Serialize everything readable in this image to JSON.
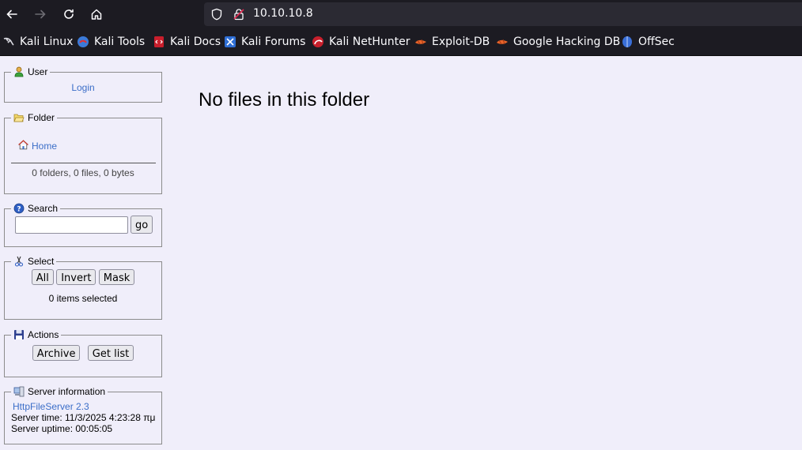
{
  "browser": {
    "url": "10.10.10.8",
    "bookmarks": [
      {
        "label": "Kali Linux",
        "icon": "kali-dragon-icon"
      },
      {
        "label": "Kali Tools",
        "icon": "kali-tools-icon"
      },
      {
        "label": "Kali Docs",
        "icon": "kali-docs-icon"
      },
      {
        "label": "Kali Forums",
        "icon": "kali-forums-icon"
      },
      {
        "label": "Kali NetHunter",
        "icon": "nethunter-icon"
      },
      {
        "label": "Exploit-DB",
        "icon": "exploit-db-icon"
      },
      {
        "label": "Google Hacking DB",
        "icon": "ghdb-icon"
      },
      {
        "label": "OffSec",
        "icon": "offsec-icon"
      }
    ]
  },
  "panels": {
    "user": {
      "title": "User",
      "login": "Login"
    },
    "folder": {
      "title": "Folder",
      "home": "Home",
      "stats": "0 folders, 0 files, 0 bytes"
    },
    "search": {
      "title": "Search",
      "go": "go",
      "value": ""
    },
    "select": {
      "title": "Select",
      "all": "All",
      "invert": "Invert",
      "mask": "Mask",
      "status": "0 items selected"
    },
    "actions": {
      "title": "Actions",
      "archive": "Archive",
      "getlist": "Get list"
    },
    "server": {
      "title": "Server information",
      "version": "HttpFileServer 2.3",
      "time": "Server time: 11/3/2025 4:23:28 πμ",
      "uptime": "Server uptime: 00:05:05"
    }
  },
  "main": {
    "message": "No files in this folder"
  }
}
